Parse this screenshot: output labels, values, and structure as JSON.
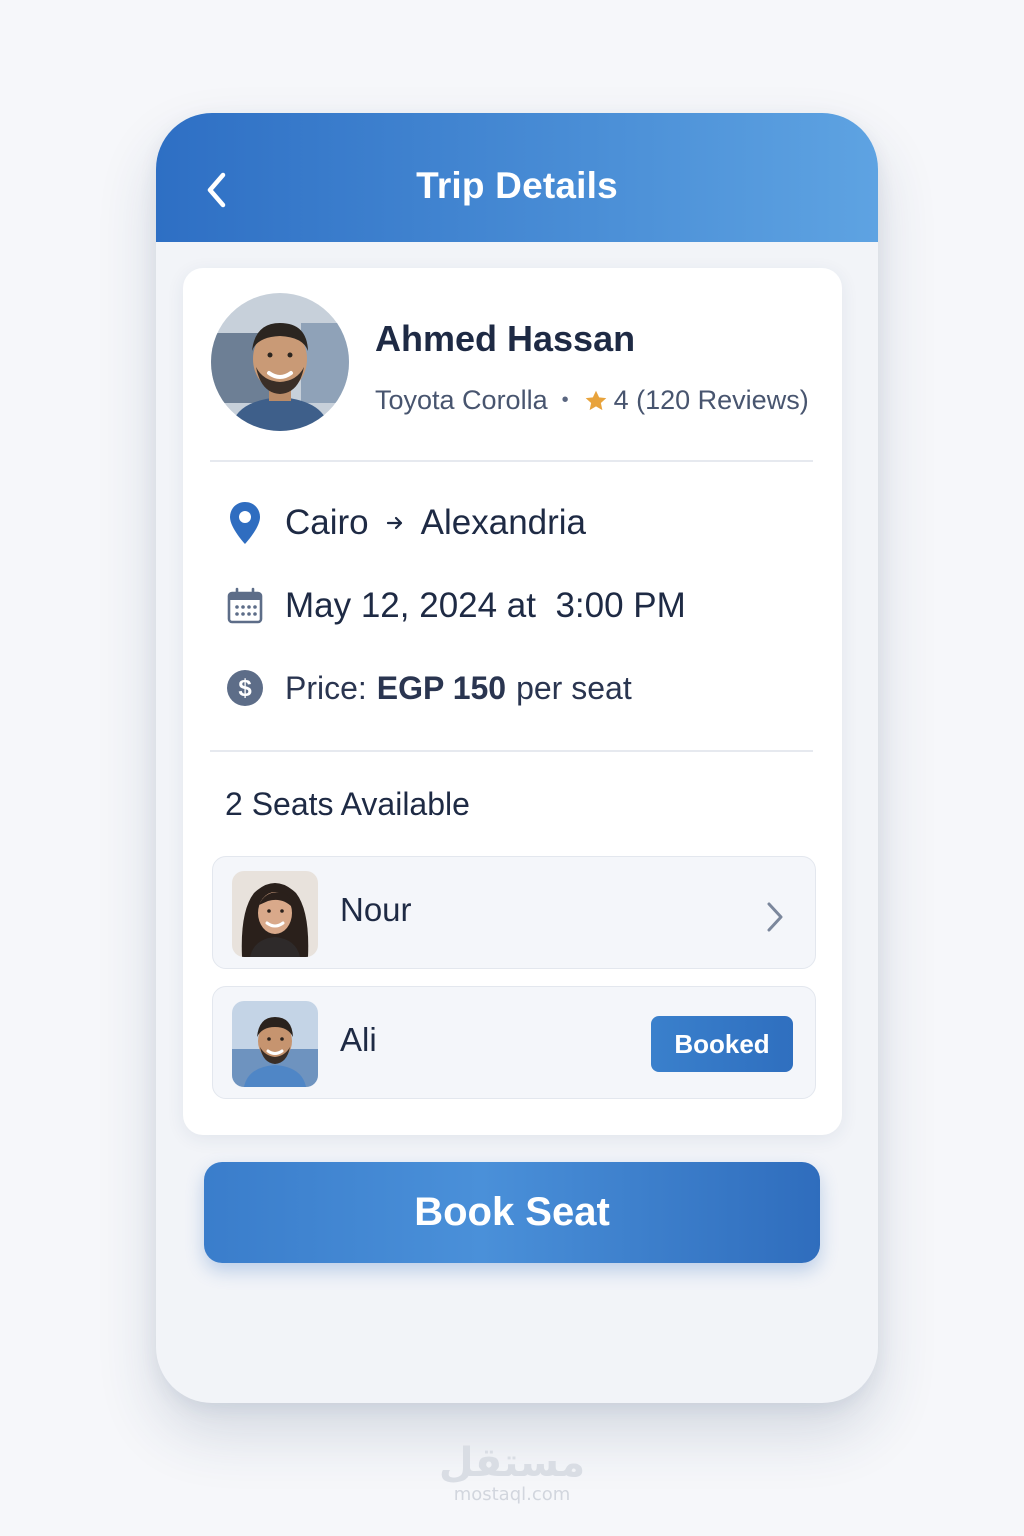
{
  "header": {
    "title": "Trip Details"
  },
  "driver": {
    "name": "Ahmed Hassan",
    "car": "Toyota Corolla",
    "separator": "•",
    "rating_text": "4 (120 Reviews)",
    "rating": 4
  },
  "trip": {
    "from": "Cairo",
    "to": "Alexandria",
    "date_time": "May 12, 2024 at  3:00 PM",
    "price_label": "Price:",
    "price_value": "EGP 150",
    "price_unit": "per seat"
  },
  "seats": {
    "title": "2 Seats Available",
    "passengers": [
      {
        "name": "Nour"
      },
      {
        "name": "Ali",
        "status": "Booked"
      }
    ]
  },
  "actions": {
    "book_label": "Book Seat"
  },
  "watermark": {
    "logo": "مستقل",
    "url": "mostaql.com"
  },
  "colors": {
    "primary": "#2e6fc4",
    "primary_light": "#5ea3e2",
    "star": "#e8a33c",
    "text": "#1e2a44"
  }
}
